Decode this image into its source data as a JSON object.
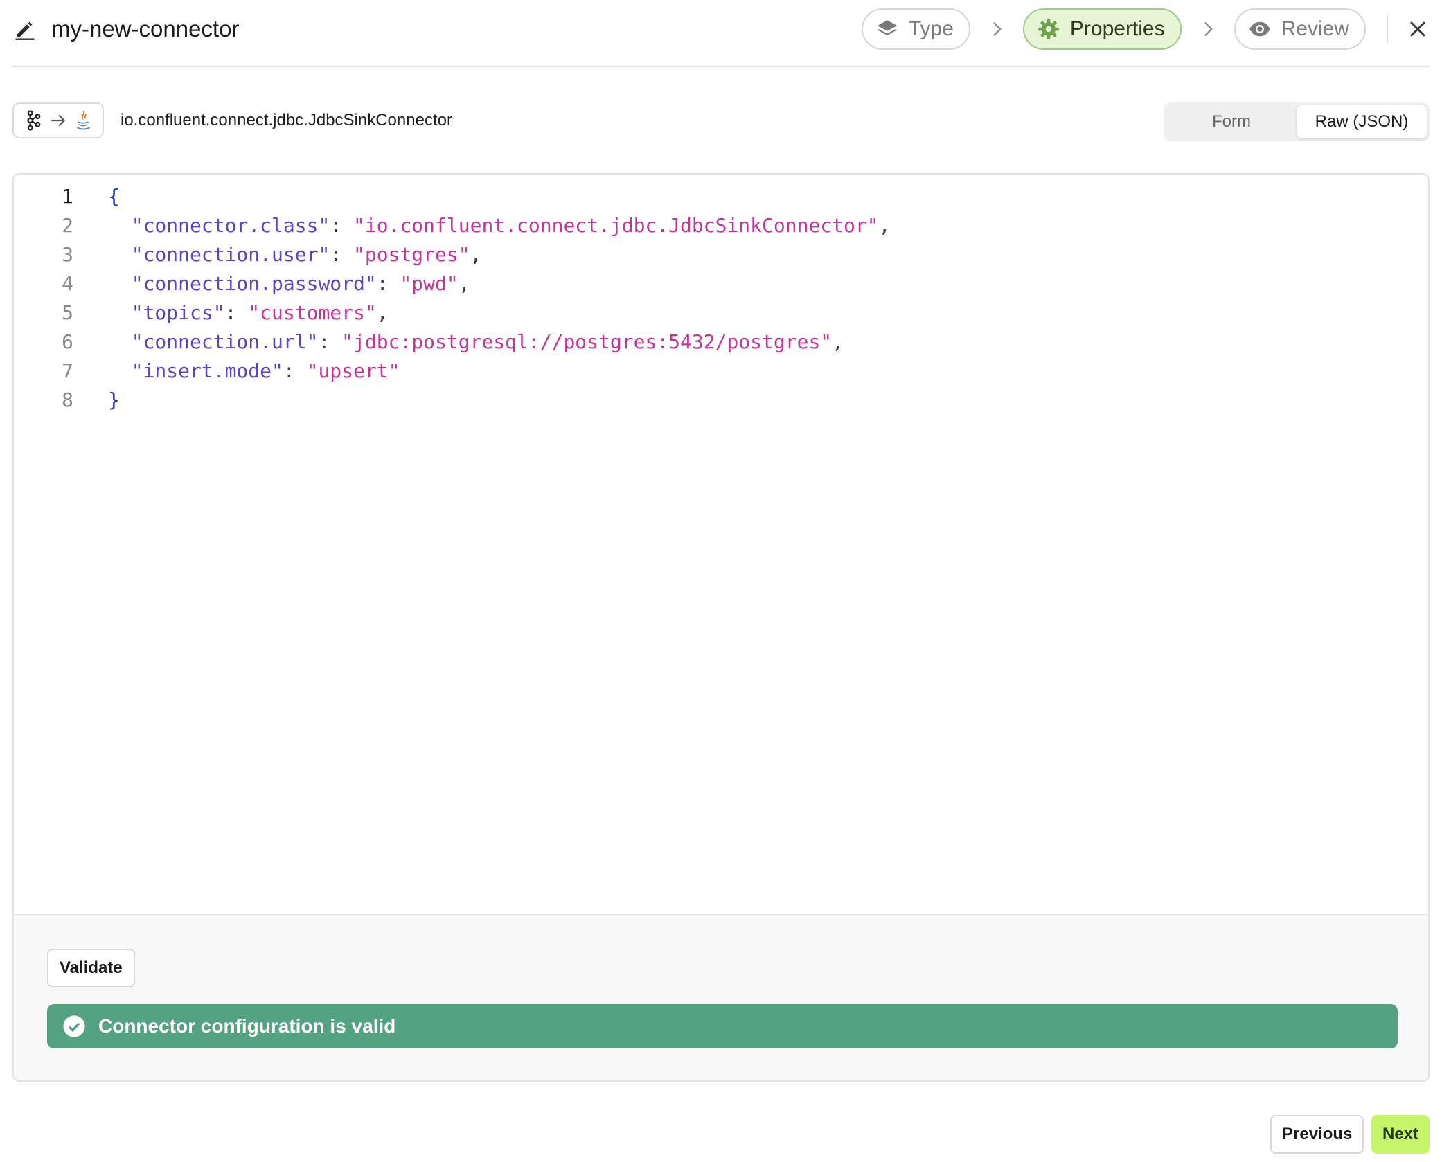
{
  "header": {
    "title": "my-new-connector",
    "steps": [
      {
        "label": "Type",
        "icon": "layers-icon",
        "state": "done"
      },
      {
        "label": "Properties",
        "icon": "gear-icon",
        "state": "active"
      },
      {
        "label": "Review",
        "icon": "eye-icon",
        "state": "pending"
      }
    ]
  },
  "connector": {
    "class_name": "io.confluent.connect.jdbc.JdbcSinkConnector",
    "badge_icons": [
      "kafka-icon",
      "arrow-right-icon",
      "java-icon"
    ]
  },
  "view_toggle": {
    "form_label": "Form",
    "raw_label": "Raw (JSON)",
    "selected": "Raw (JSON)"
  },
  "editor": {
    "lines": [
      {
        "n": "1",
        "text": "{"
      },
      {
        "n": "2",
        "key": "\"connector.class\"",
        "value": "\"io.confluent.connect.jdbc.JdbcSinkConnector\"",
        "comma": ","
      },
      {
        "n": "3",
        "key": "\"connection.user\"",
        "value": "\"postgres\"",
        "comma": ","
      },
      {
        "n": "4",
        "key": "\"connection.password\"",
        "value": "\"pwd\"",
        "comma": ","
      },
      {
        "n": "5",
        "key": "\"topics\"",
        "value": "\"customers\"",
        "comma": ","
      },
      {
        "n": "6",
        "key": "\"connection.url\"",
        "value": "\"jdbc:postgresql://postgres:5432/postgres\"",
        "comma": ","
      },
      {
        "n": "7",
        "key": "\"insert.mode\"",
        "value": "\"upsert\"",
        "comma": ""
      },
      {
        "n": "8",
        "text": "}"
      }
    ]
  },
  "validation": {
    "button_label": "Validate",
    "message": "Connector configuration is valid",
    "color": "#53a383"
  },
  "nav": {
    "previous_label": "Previous",
    "next_label": "Next",
    "next_color": "#c6f56b"
  },
  "colors": {
    "accent_active_step": "#e6f5d3",
    "json_key": "#5646bf",
    "json_string": "#c2369a",
    "json_brace": "#2133c7"
  }
}
